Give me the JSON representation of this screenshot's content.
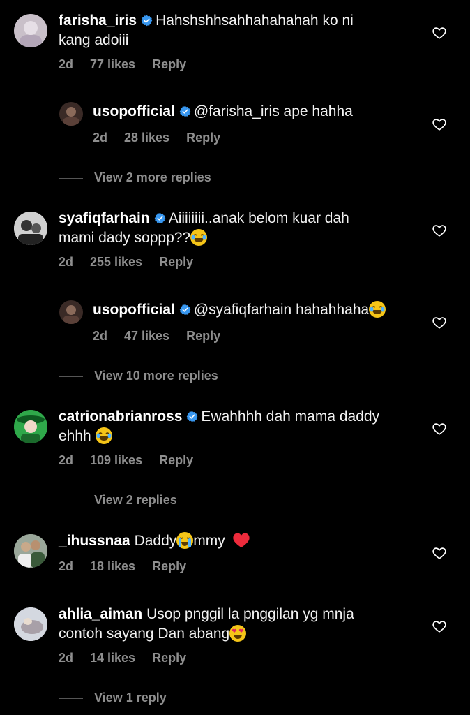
{
  "comments": [
    {
      "username": "farisha_iris",
      "text_line1": "Hahshshhsahhahahahah ko ni",
      "text_line2": "kang adoiii",
      "time": "2d",
      "likes": "77 likes",
      "reply": "Reply"
    },
    {
      "username": "usopofficial",
      "text_line1": "@farisha_iris ape hahha",
      "time": "2d",
      "likes": "28 likes",
      "reply": "Reply"
    },
    {
      "view_more": "View 2 more replies"
    },
    {
      "username": "syafiqfarhain",
      "text_line1": "Aiiiiiiii..anak belom kuar  dah",
      "text_line2": "mami dady soppp??",
      "time": "2d",
      "likes": "255 likes",
      "reply": "Reply"
    },
    {
      "username": "usopofficial",
      "text_line1": "@syafiqfarhain hahahhaha",
      "time": "2d",
      "likes": "47 likes",
      "reply": "Reply"
    },
    {
      "view_more": "View 10 more replies"
    },
    {
      "username": "catrionabrianross",
      "text_line1": "Ewahhhh dah mama daddy",
      "text_line2": "ehhh",
      "time": "2d",
      "likes": "109 likes",
      "reply": "Reply"
    },
    {
      "view_more": "View 2 replies"
    },
    {
      "username": "_ihussnaa",
      "text_part1": "Daddy",
      "text_part2": "mmy",
      "time": "2d",
      "likes": "18 likes",
      "reply": "Reply"
    },
    {
      "username": "ahlia_aiman",
      "text_line1": "Usop pnggil la pnggilan yg mnja",
      "text_line2": "contoh sayang Dan abang",
      "time": "2d",
      "likes": "14 likes",
      "reply": "Reply"
    },
    {
      "view_more": "View 1 reply"
    }
  ],
  "colors": {
    "background": "#000000",
    "text": "#ffffff",
    "meta": "#8e8e8e",
    "verified": "#3897f0",
    "heart_red": "#ed2b3c"
  }
}
